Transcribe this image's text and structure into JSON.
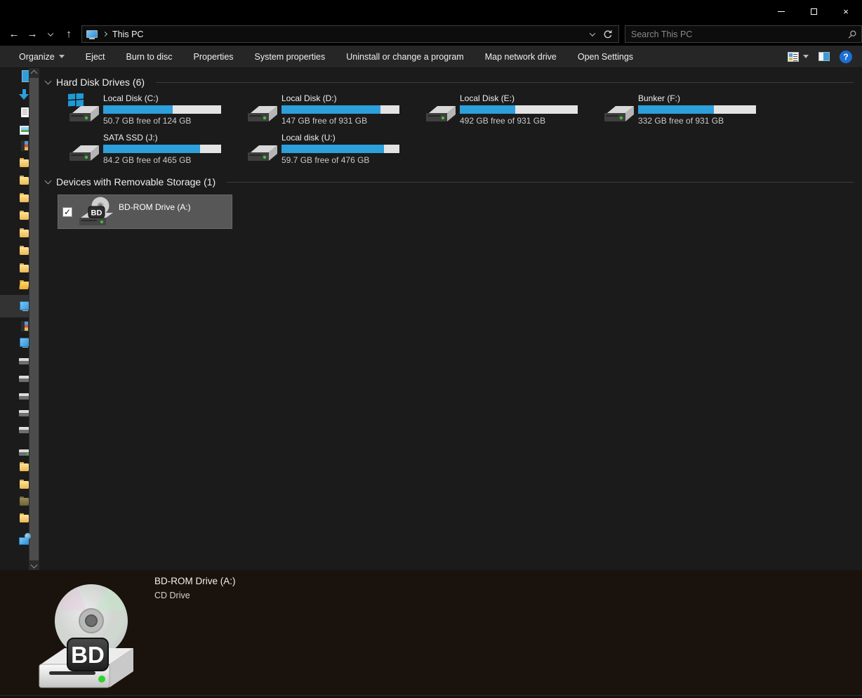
{
  "titlebar": {
    "close_glyph": "×"
  },
  "nav": {
    "back": "←",
    "forward": "→",
    "up": "↑",
    "address": {
      "location": "This PC"
    },
    "search": {
      "placeholder": "Search This PC"
    }
  },
  "toolbar": {
    "items": [
      "Organize",
      "Eject",
      "Burn to disc",
      "Properties",
      "System properties",
      "Uninstall or change a program",
      "Map network drive",
      "Open Settings"
    ],
    "help_glyph": "?"
  },
  "sidebar": {
    "icons": [
      "quick-access",
      "downloads",
      "documents",
      "pictures",
      "videos",
      "folder",
      "folder",
      "folder",
      "folder",
      "folder",
      "folder",
      "folder",
      "user-folder",
      "this-pc",
      "videos",
      "desktop",
      "drive",
      "drive",
      "drive",
      "drive",
      "drive",
      "drive-active",
      "folder",
      "folder",
      "folder-dark",
      "folder",
      "network"
    ],
    "selected_index": 13
  },
  "sections": {
    "hard_disks": {
      "title": "Hard Disk Drives (6)",
      "drives": [
        {
          "name": "Local Disk (C:)",
          "free": "50.7 GB free of 124 GB",
          "used_pct": 59
        },
        {
          "name": "Local Disk (D:)",
          "free": "147 GB free of 931 GB",
          "used_pct": 84
        },
        {
          "name": "Local Disk (E:)",
          "free": "492 GB free of 931 GB",
          "used_pct": 47
        },
        {
          "name": "Bunker (F:)",
          "free": "332 GB free of 931 GB",
          "used_pct": 64
        },
        {
          "name": "SATA SSD (J:)",
          "free": "84.2 GB free of 465 GB",
          "used_pct": 82
        },
        {
          "name": "Local disk (U:)",
          "free": "59.7 GB free of 476 GB",
          "used_pct": 87
        }
      ]
    },
    "removable": {
      "title": "Devices with Removable Storage (1)",
      "items": [
        {
          "name": "BD-ROM Drive (A:)",
          "badge": "BD",
          "checked": "✓"
        }
      ]
    }
  },
  "details": {
    "title": "BD-ROM Drive (A:)",
    "subtitle": "CD Drive",
    "badge": "BD"
  },
  "colors": {
    "accent_blue": "#2d9fdb",
    "bar_track": "#e3e3e3",
    "selection_gray": "#575757",
    "help_blue": "#1b6fd6"
  }
}
